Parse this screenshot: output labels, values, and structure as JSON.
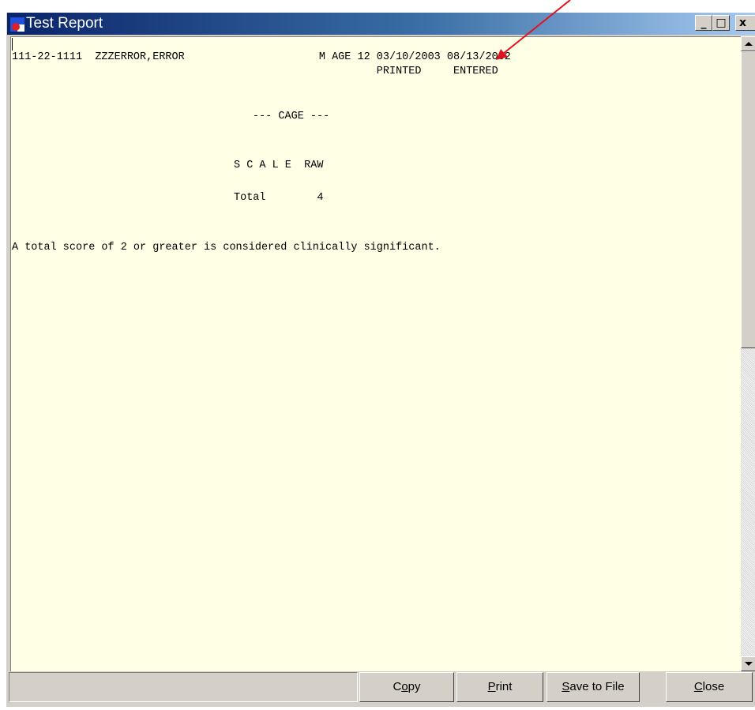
{
  "window": {
    "title": "Test Report",
    "controls": {
      "minimize": "_",
      "maximize": "□",
      "close": "x"
    }
  },
  "report": {
    "lines": {
      "header": "111-22-1111  ZZZERROR,ERROR                     M AGE 12 03/10/2003 08/13/2002",
      "subheader": "                                                         PRINTED     ENTERED",
      "section_title": "--- CAGE ---",
      "table_header": "S C A L E  RAW",
      "total_row": "Total        4",
      "note": "A total score of 2 or greater is considered clinically significant."
    }
  },
  "buttons": {
    "copy": {
      "pre": "C",
      "key": "o",
      "post": "py"
    },
    "print": {
      "pre": "",
      "key": "P",
      "post": "rint"
    },
    "save": {
      "pre": "",
      "key": "S",
      "post": "ave to File"
    },
    "close": {
      "pre": "",
      "key": "C",
      "post": "lose"
    }
  },
  "colors": {
    "content_background": "#ffffe6",
    "annotation_arrow": "#e0141e"
  },
  "icons": {
    "app": "app-icon",
    "scroll_up": "arrow-up-icon",
    "scroll_down": "arrow-down-icon"
  }
}
